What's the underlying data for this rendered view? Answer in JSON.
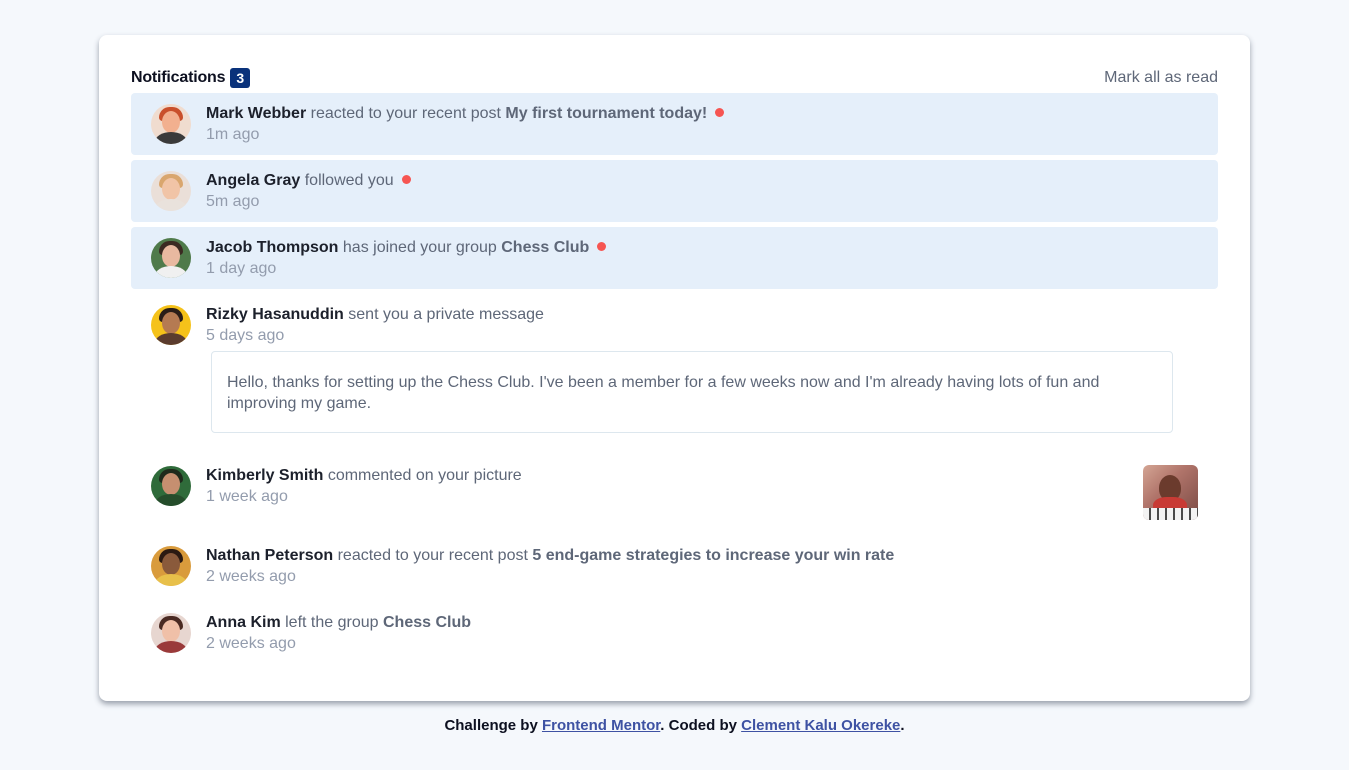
{
  "header": {
    "title": "Notifications",
    "unread_count": "3",
    "mark_all": "Mark all as read"
  },
  "notifications": [
    {
      "name": "Mark Webber",
      "action": "reacted to your recent post",
      "target": "My first tournament today!",
      "time": "1m ago",
      "unread": true
    },
    {
      "name": "Angela Gray",
      "action": "followed you",
      "target": "",
      "time": "5m ago",
      "unread": true
    },
    {
      "name": "Jacob Thompson",
      "action": "has joined your group",
      "target": "Chess Club",
      "time": "1 day ago",
      "unread": true
    },
    {
      "name": "Rizky Hasanuddin",
      "action": "sent you a private message",
      "target": "",
      "time": "5 days ago",
      "unread": false,
      "message": "Hello, thanks for setting up the Chess Club. I've been a member for a few weeks now and I'm already having lots of fun and improving my game."
    },
    {
      "name": "Kimberly Smith",
      "action": "commented on your picture",
      "target": "",
      "time": "1 week ago",
      "unread": false,
      "has_picture": true
    },
    {
      "name": "Nathan Peterson",
      "action": "reacted to your recent post",
      "target": "5 end-game strategies to increase your win rate",
      "time": "2 weeks ago",
      "unread": false
    },
    {
      "name": "Anna Kim",
      "action": "left the group",
      "target": "Chess Club",
      "time": "2 weeks ago",
      "unread": false
    }
  ],
  "footer": {
    "prefix": "Challenge by",
    "link1": "Frontend Mentor",
    "middle": ". Coded by",
    "link2": "Clement Kalu Okereke",
    "suffix": "."
  },
  "colors": {
    "unread_bg": "#e5effa",
    "badge": "#0a327b",
    "dot": "#f65552",
    "link": "#3e52a3"
  }
}
